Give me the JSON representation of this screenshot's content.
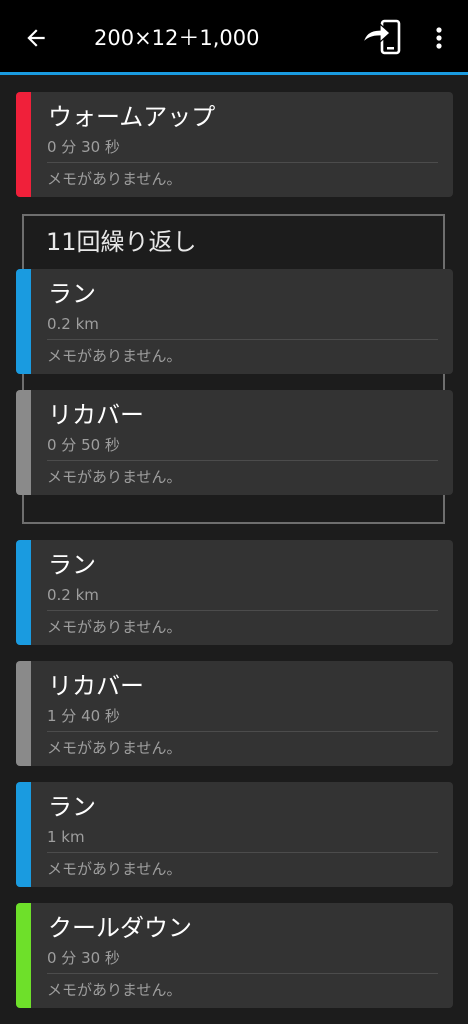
{
  "header": {
    "title": "200×12＋1,000",
    "back_icon": "arrow-left-icon",
    "send_icon": "send-to-device-icon",
    "menu_icon": "more-vertical-icon"
  },
  "colors": {
    "accent": "#1a9be0",
    "warmup": "#f0203a",
    "run": "#1a9be0",
    "recovery": "#8a8a8a",
    "cooldown": "#6ee02a"
  },
  "repeat": {
    "label": "11回繰り返し"
  },
  "steps": [
    {
      "name": "ウォームアップ",
      "detail": "0 分 30 秒",
      "memo": "メモがありません。",
      "type": "warmup"
    },
    {
      "name": "ラン",
      "detail": "0.2 km",
      "memo": "メモがありません。",
      "type": "run"
    },
    {
      "name": "リカバー",
      "detail": "0 分 50 秒",
      "memo": "メモがありません。",
      "type": "recovery"
    },
    {
      "name": "ラン",
      "detail": "0.2 km",
      "memo": "メモがありません。",
      "type": "run"
    },
    {
      "name": "リカバー",
      "detail": "1 分 40 秒",
      "memo": "メモがありません。",
      "type": "recovery"
    },
    {
      "name": "ラン",
      "detail": "1 km",
      "memo": "メモがありません。",
      "type": "run"
    },
    {
      "name": "クールダウン",
      "detail": "0 分 30 秒",
      "memo": "メモがありません。",
      "type": "cooldown"
    }
  ]
}
